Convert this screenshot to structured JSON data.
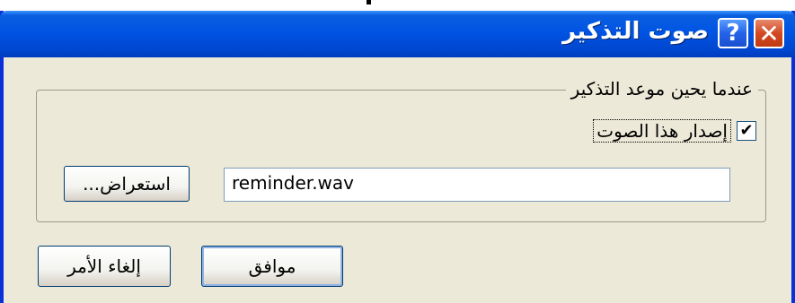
{
  "window": {
    "title": "صوت التذكير",
    "help_glyph": "?",
    "close_glyph": "✕"
  },
  "group": {
    "label": "عندما يحين موعد التذكير",
    "checkbox_label": "إصدار هذا الصوت",
    "checkbox_checked": true,
    "checkbox_mark": "✔",
    "file_value": "reminder.wav",
    "browse_label": "استعراض..."
  },
  "buttons": {
    "ok_label": "موافق",
    "cancel_label": "إلغاء الأمر"
  },
  "colors": {
    "titlebar": "#0054e3",
    "dialog_bg": "#ece9d8",
    "close_button": "#d34a22"
  }
}
